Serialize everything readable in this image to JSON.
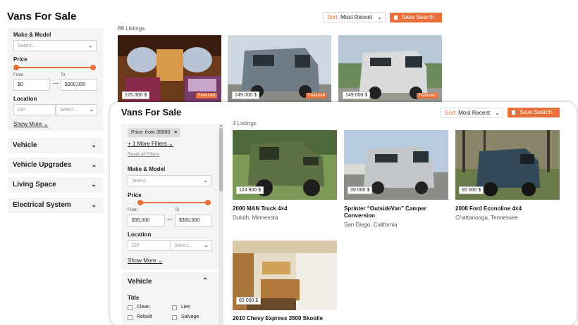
{
  "page": {
    "title": "Vans For Sale",
    "listing_count": "89 Listings",
    "sort_label": "Sort:",
    "sort_value": "Most Recent",
    "save_search": "Save Search"
  },
  "sidebar": {
    "make_model_label": "Make & Model",
    "make_model_placeholder": "Select...",
    "price_label": "Price",
    "from_label": "From",
    "to_label": "To",
    "price_from": "$0",
    "price_to": "$300,000",
    "location_label": "Location",
    "zip_placeholder": "ZIP",
    "location_select_placeholder": "Select...",
    "show_more": "Show More",
    "sections": [
      "Vehicle",
      "Vehicle Upgrades",
      "Living Space",
      "Electrical System"
    ]
  },
  "top_listings": [
    {
      "price": "125 000 $",
      "badge": "Featured"
    },
    {
      "price": "149 000 $",
      "badge": "Featured"
    },
    {
      "price": "149 000 $",
      "badge": "Featured"
    }
  ],
  "card": {
    "title": "Vans For Sale",
    "listing_count": "4 Listings",
    "sort_label": "Sort:",
    "sort_value": "Most Recent",
    "save_search": "Save Search",
    "filters": {
      "active_chip": "Price: from 35000",
      "more_filters": "+ 1 More Filters",
      "reset": "Reset all Filters",
      "make_model_label": "Make & Model",
      "make_model_placeholder": "Select...",
      "price_label": "Price",
      "from_label": "From",
      "to_label": "To",
      "price_from": "$35,000",
      "price_to": "$300,000",
      "location_label": "Location",
      "zip_placeholder": "ZIP",
      "location_select_placeholder": "Select...",
      "show_more": "Show More",
      "vehicle_section": "Vehicle",
      "title_label": "Title",
      "title_options": [
        "Clean",
        "Lien",
        "Rebuilt",
        "Salvage"
      ]
    },
    "listings": [
      {
        "price": "124 900 $",
        "title": "2000 MAN Truck 4×4",
        "location": "Duluth, Minnesota"
      },
      {
        "price": "39 000 $",
        "title": "Sprinter “OutsideVan” Camper Conversion",
        "location": "San Diego, California"
      },
      {
        "price": "65 000 $",
        "title": "2008 Ford Econoline 4×4",
        "location": "Chattanooga, Tennessee"
      },
      {
        "price": "65 000 $",
        "title": "2010 Chevy Express 3500 Skoolie",
        "location": ""
      }
    ]
  },
  "colors": {
    "accent": "#e8703a",
    "panel": "#f4f4f4"
  }
}
